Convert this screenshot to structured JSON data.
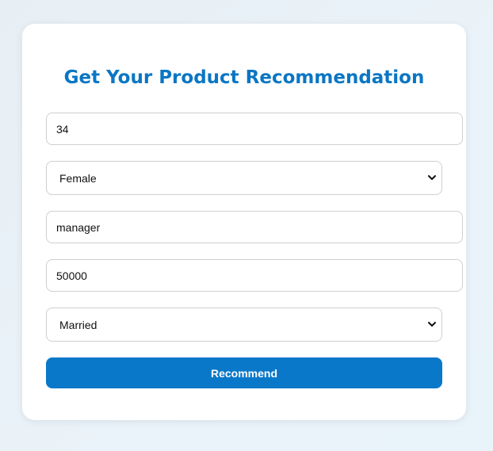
{
  "form": {
    "title": "Get Your Product Recommendation",
    "age": {
      "value": "34"
    },
    "gender": {
      "selected": "Female",
      "chevron_icon": "chevron-down-icon"
    },
    "occupation": {
      "value": "manager"
    },
    "income": {
      "value": "50000"
    },
    "marital_status": {
      "selected": "Married",
      "chevron_icon": "chevron-down-icon"
    },
    "submit_label": "Recommend"
  },
  "colors": {
    "accent": "#0a78c9",
    "title": "#0a76c4",
    "background": "#eaf3f9",
    "card": "#ffffff"
  }
}
